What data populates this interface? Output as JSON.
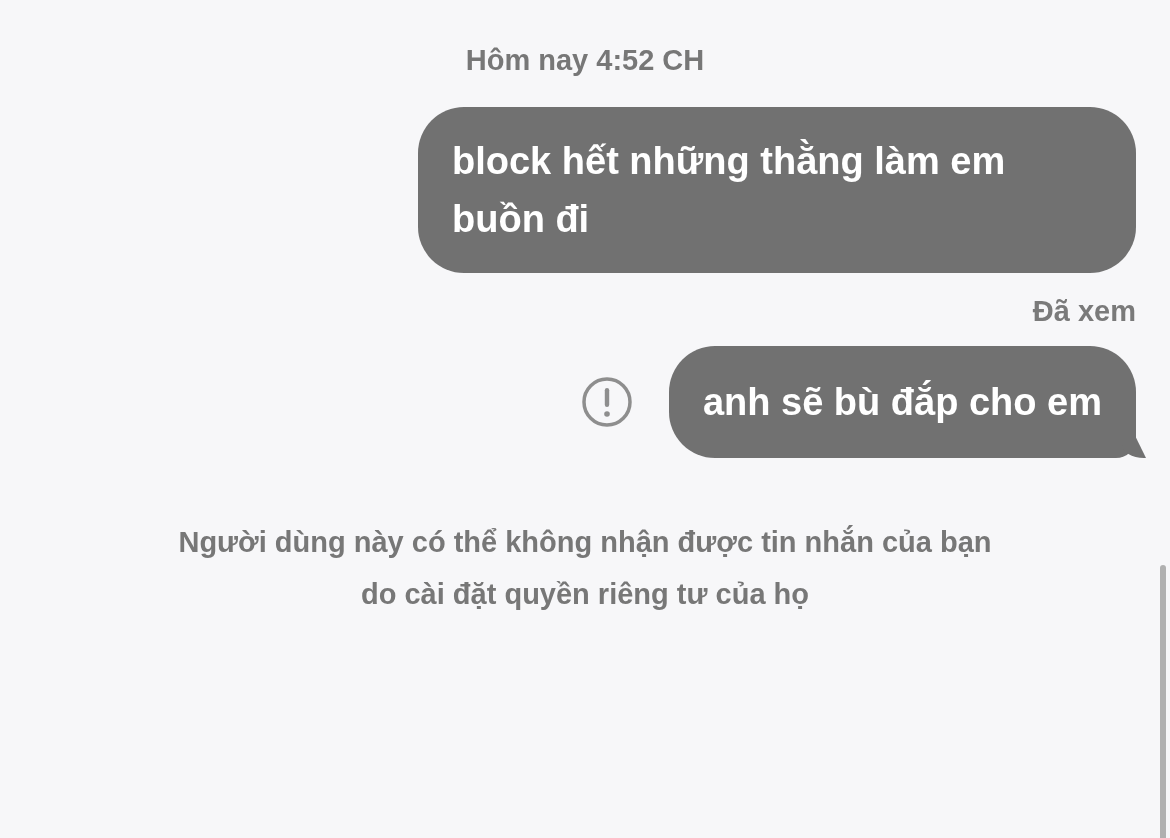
{
  "items": [
    {
      "kind": "timestamp",
      "text": "Hôm nay 4:52 CH"
    },
    {
      "kind": "message",
      "text": "block hết những thằng làm em buồn đi",
      "failed": false,
      "tail": false
    },
    {
      "kind": "receipt",
      "text": "Đã xem"
    },
    {
      "kind": "message",
      "text": "anh sẽ bù đắp cho em",
      "failed": true,
      "tail": true
    },
    {
      "kind": "notice",
      "text": "Người dùng này có thể không nhận được tin nhắn của bạn do cài đặt quyền riêng tư của họ"
    }
  ]
}
